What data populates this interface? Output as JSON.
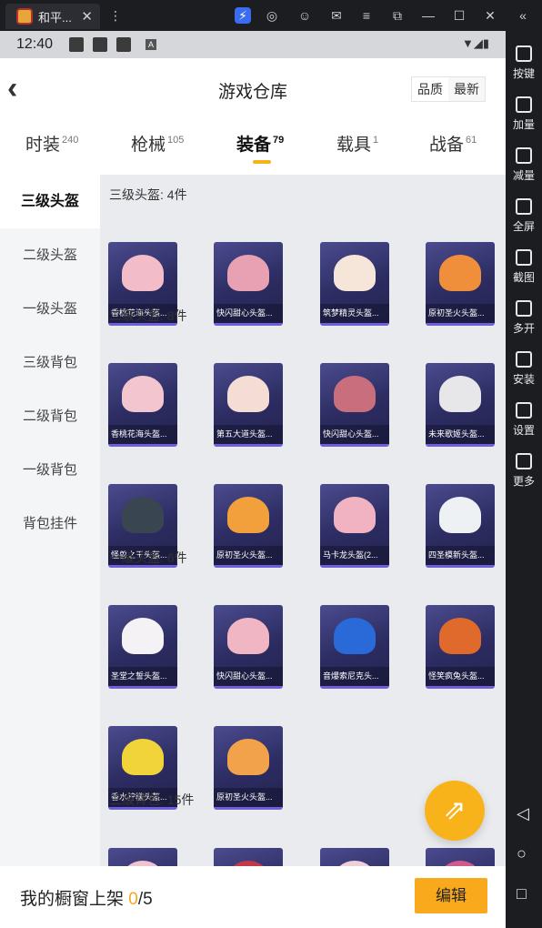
{
  "window": {
    "tab_title": "和平...",
    "tab_close": "✕"
  },
  "emulator_sidebar": {
    "buttons": [
      "按键",
      "加量",
      "减量",
      "全屏",
      "截图",
      "多开",
      "安装",
      "设置",
      "更多"
    ]
  },
  "statusbar": {
    "time": "12:40",
    "app_icon_letter": "A"
  },
  "header": {
    "back_glyph": "‹",
    "title": "游戏仓库",
    "sort": [
      "品质",
      "最新"
    ]
  },
  "categories": [
    {
      "label": "时装",
      "count": "240"
    },
    {
      "label": "枪械",
      "count": "105"
    },
    {
      "label": "装备",
      "count": "79"
    },
    {
      "label": "载具",
      "count": "1"
    },
    {
      "label": "战备",
      "count": "61"
    }
  ],
  "left_nav": [
    "三级头盔",
    "二级头盔",
    "一级头盔",
    "三级背包",
    "二级背包",
    "一级背包",
    "背包挂件"
  ],
  "sections": [
    {
      "title": "三级头盔: 4件",
      "items": [
        "香桃花海头盔...",
        "快闪甜心头盔...",
        "筑梦精灵头盔...",
        "原初圣火头盔..."
      ]
    },
    {
      "title": "二级头盔: 8件",
      "items": [
        "香桃花海头盔...",
        "第五大道头盔...",
        "快闪甜心头盔...",
        "未来歌姬头盔...",
        "怪兽之王头盔...",
        "原初圣火头盔...",
        "马卡龙头盔(2...",
        "四圣模新头盔..."
      ]
    },
    {
      "title": "一级头盔: 6件",
      "items": [
        "圣堂之誓头盔...",
        "快闪甜心头盔...",
        "音爆索尼克头...",
        "怪笑疯兔头盔...",
        "香水柠檬头盔...",
        "原初圣火头盔..."
      ]
    },
    {
      "title": "三级背包: 15件",
      "items": []
    }
  ],
  "item_colors": [
    "#f2bcc8",
    "#e8a1b2",
    "#f6e6d9",
    "#ef8f3c",
    "#f3c6cf",
    "#f5ddd6",
    "#c96e7c",
    "#e7e7ea",
    "#394652",
    "#f2a03c",
    "#f1b3c2",
    "#eef1f4",
    "#f5f2f6",
    "#f0b6c3",
    "#2a6ad8",
    "#e06a2c",
    "#f1d43a",
    "#f2a24a"
  ],
  "fab": {
    "icon": "share-external-icon",
    "glyph": "⇗"
  },
  "bottom": {
    "label": "我的橱窗上架",
    "current": "0",
    "total": "/5",
    "edit_label": "编辑"
  }
}
